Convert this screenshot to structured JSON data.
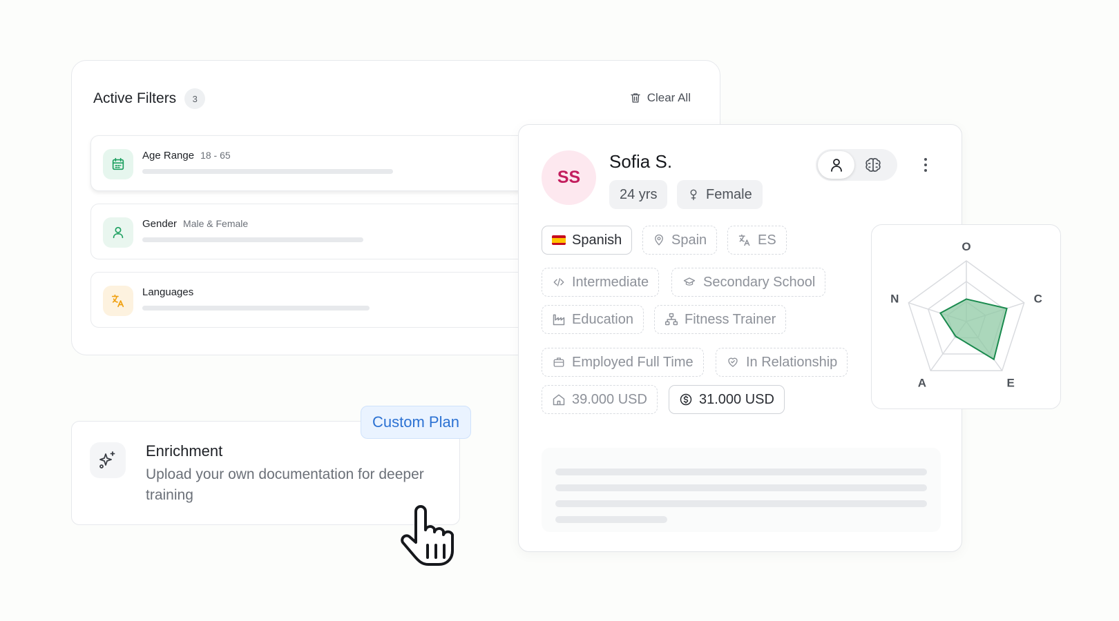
{
  "filters": {
    "title": "Active Filters",
    "count": "3",
    "clear_label": "Clear All",
    "items": [
      {
        "label": "Age Range",
        "value": "18 - 65",
        "icon": "calendar-icon",
        "color": "#1a9e5e"
      },
      {
        "label": "Gender",
        "value": "Male & Female",
        "icon": "user-icon",
        "color": "#1a9e5e"
      },
      {
        "label": "Languages",
        "value": "",
        "icon": "translate-icon",
        "color": "#f0a010"
      }
    ]
  },
  "enrichment": {
    "icon": "sparkles-icon",
    "title": "Enrichment",
    "description": "Upload your own documentation for deeper training",
    "badge": "Custom Plan"
  },
  "profile": {
    "initials": "SS",
    "name": "Sofia S.",
    "age": "24 yrs",
    "gender": "Female",
    "view_icons": [
      "person-icon",
      "brain-icon"
    ],
    "tags": {
      "language": "Spanish",
      "country": "Spain",
      "lang_code": "ES",
      "level": "Intermediate",
      "school": "Secondary School",
      "industry": "Education",
      "occupation": "Fitness Trainer",
      "employment": "Employed Full Time",
      "relationship": "In Relationship",
      "household_income": "39.000 USD",
      "personal_income": "31.000 USD"
    }
  },
  "radar": {
    "axes": [
      "O",
      "C",
      "E",
      "A",
      "N"
    ],
    "values": [
      0.37,
      0.7,
      0.77,
      0.3,
      0.45
    ],
    "fill": "#8fcaa4",
    "stroke": "#1a8a4e"
  },
  "colors": {
    "accent_blue": "#2c72d3",
    "avatar_text": "#c31e5e",
    "filter_green": "#1a9e5e"
  }
}
